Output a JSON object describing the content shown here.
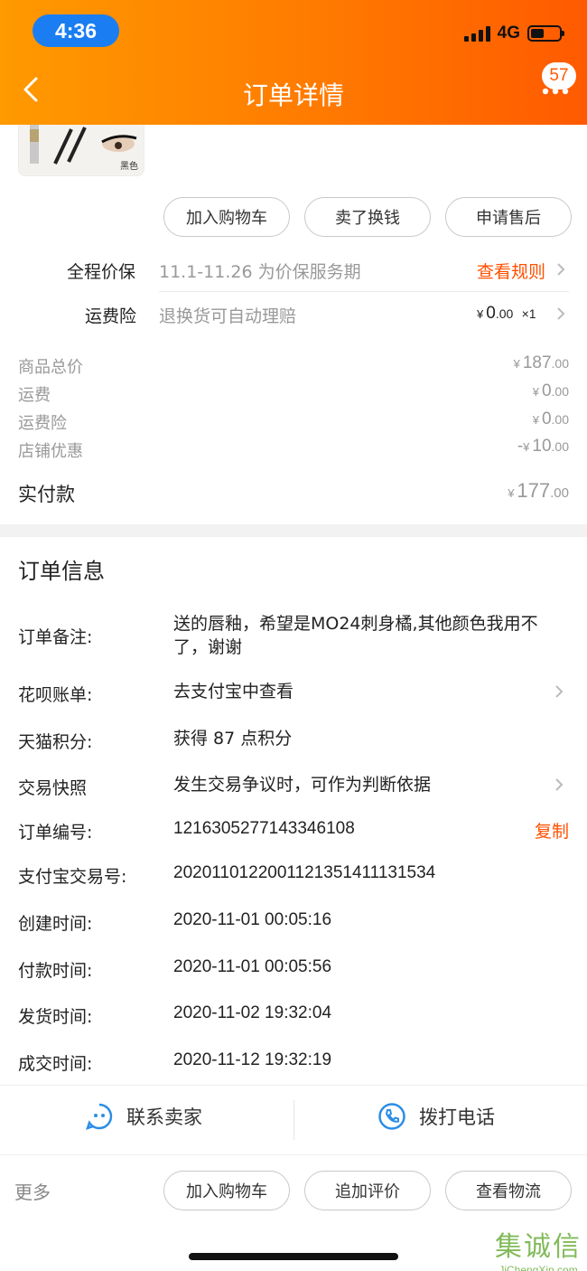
{
  "status_bar": {
    "time": "4:36",
    "network": "4G"
  },
  "header": {
    "title": "订单详情",
    "badge_count": "57"
  },
  "product": {
    "thumb_label": "黑色"
  },
  "product_actions": [
    "加入购物车",
    "卖了换钱",
    "申请售后"
  ],
  "service_rows": {
    "price_protect": {
      "label": "全程价保",
      "desc": "11.1-11.26 为价保服务期",
      "action": "查看规则"
    },
    "shipping_insurance": {
      "label": "运费险",
      "desc": "退换货可自动理赔",
      "amount": "0",
      "amount_decimal": ".00",
      "qty": "×1"
    }
  },
  "price_summary": {
    "currency": "¥",
    "rows": [
      {
        "label": "商品总价",
        "int": "187",
        "dec": ".00",
        "prefix": ""
      },
      {
        "label": "运费",
        "int": "0",
        "dec": ".00",
        "prefix": ""
      },
      {
        "label": "运费险",
        "int": "0",
        "dec": ".00",
        "prefix": ""
      },
      {
        "label": "店铺优惠",
        "int": "10",
        "dec": ".00",
        "prefix": "-"
      }
    ],
    "paid_label": "实付款",
    "paid_int": "177",
    "paid_dec": ".00"
  },
  "order_info": {
    "title": "订单信息",
    "remark_label": "订单备注:",
    "remark_value": "送的唇釉，希望是MO24刺身橘,其他颜色我用不了，谢谢",
    "huabei_label": "花呗账单:",
    "huabei_value": "去支付宝中查看",
    "points_label": "天猫积分:",
    "points_value": "获得 87 点积分",
    "snapshot_label": "交易快照",
    "snapshot_value": "发生交易争议时，可作为判断依据",
    "order_no_label": "订单编号:",
    "order_no_value": "1216305277143346108",
    "copy_label": "复制",
    "alipay_no_label": "支付宝交易号:",
    "alipay_no_value": "2020110122001121351411131534",
    "created_label": "创建时间:",
    "created_value": "2020-11-01 00:05:16",
    "paid_time_label": "付款时间:",
    "paid_time_value": "2020-11-01 00:05:56",
    "shipped_label": "发货时间:",
    "shipped_value": "2020-11-02 19:32:04",
    "closed_label": "成交时间:",
    "closed_value": "2020-11-12 19:32:19"
  },
  "contact": {
    "seller_label": "联系卖家",
    "call_label": "拨打电话"
  },
  "bottom_bar": {
    "more_label": "更多",
    "actions": [
      "加入购物车",
      "追加评价",
      "查看物流"
    ]
  },
  "watermark": {
    "main": "集诚信",
    "sub": "JiChengXin.com"
  },
  "colors": {
    "accent": "#ff5000",
    "header_from": "#ff9a00",
    "header_to": "#ff5a00",
    "icon_blue": "#2b8de6"
  }
}
